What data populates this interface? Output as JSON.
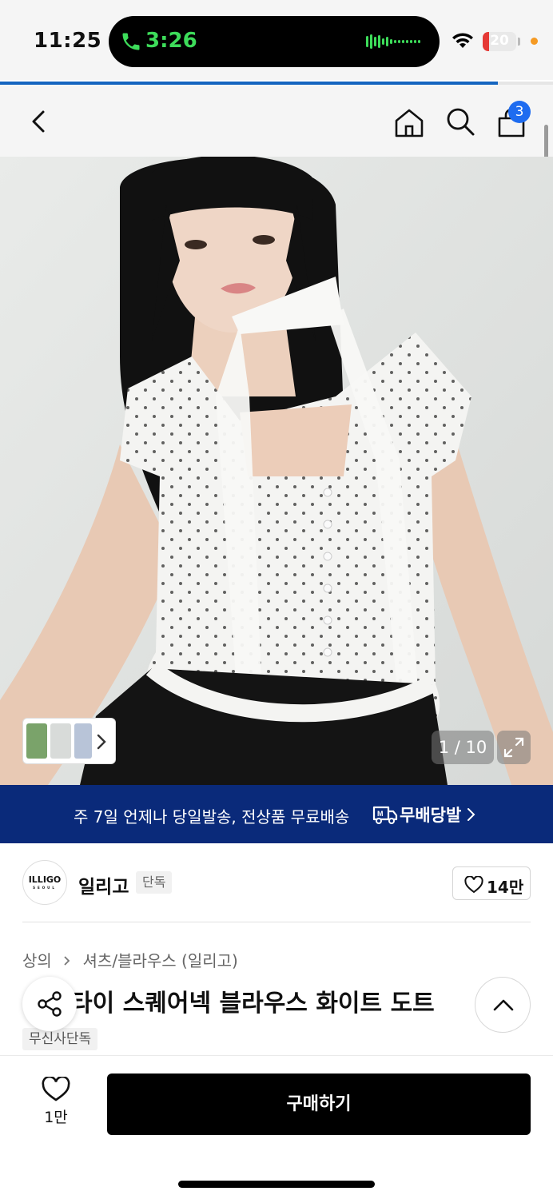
{
  "status_bar": {
    "time": "11:25",
    "call_time": "3:26",
    "battery": "20",
    "battery_level": 0.2
  },
  "page_progress": 0.9,
  "nav": {
    "icons": [
      "back-icon",
      "home-icon",
      "search-icon",
      "shopping-bag-icon"
    ],
    "cart_count": "3"
  },
  "gallery": {
    "counter": "1 / 10",
    "icons": [
      "chevron-right-icon",
      "expand-icon"
    ]
  },
  "banner": {
    "text": "주 7일 언제나 당일발송, 전상품 무료배송",
    "brand": "무배당발",
    "icons": [
      "truck-icon",
      "chevron-right-icon"
    ]
  },
  "brand": {
    "logo_text": "ILLIGO",
    "logo_sub": "SEOUL",
    "name": "일리고",
    "badge": "단독",
    "like_count": "14만"
  },
  "product": {
    "breadcrumb": [
      "상의",
      "셔츠/블라우스 (일리고)"
    ],
    "title": "타이 스퀘어넥 블라우스 화이트 도트",
    "badge": "무신사단독"
  },
  "bottom_bar": {
    "wish_count": "1만",
    "buy_label": "구매하기"
  },
  "colors": {
    "accent": "#1e6cf0",
    "banner_bg": "#0a2a7a",
    "call_green": "#3ddc5a",
    "battery_red": "#e53935"
  }
}
